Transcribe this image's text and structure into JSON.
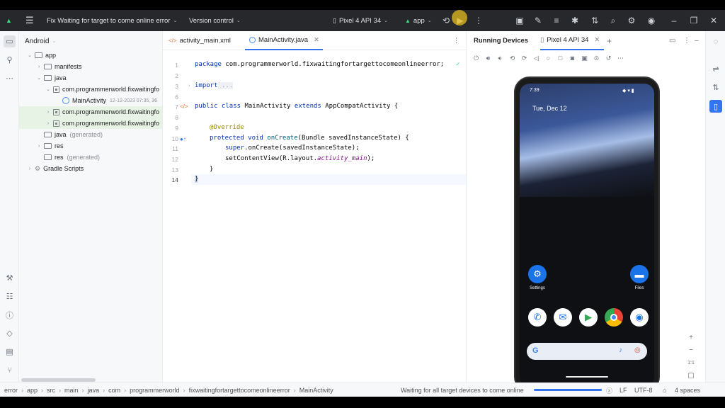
{
  "toolbar": {
    "project_name": "Fix Waiting for target to come online error",
    "version_control": "Version control",
    "device": "Pixel 4 API 34",
    "run_config": "app"
  },
  "project": {
    "view_selector": "Android",
    "tree": [
      {
        "label": "app",
        "indent": 0,
        "icon": "folder",
        "arrow": "down"
      },
      {
        "label": "manifests",
        "indent": 1,
        "icon": "folder",
        "arrow": "right"
      },
      {
        "label": "java",
        "indent": 1,
        "icon": "folder",
        "arrow": "down"
      },
      {
        "label": "com.programmerworld.fixwaitingfo",
        "indent": 2,
        "icon": "package",
        "arrow": "down"
      },
      {
        "label": "MainActivity",
        "suffix": "12-12-2023 07:35, 36",
        "indent": 3,
        "icon": "class",
        "arrow": ""
      },
      {
        "label": "com.programmerworld.fixwaitingfo",
        "indent": 2,
        "icon": "package",
        "arrow": "right",
        "selected": true
      },
      {
        "label": "com.programmerworld.fixwaitingfo",
        "indent": 2,
        "icon": "package",
        "arrow": "right",
        "selected": true
      },
      {
        "label": "java",
        "suffix": "(generated)",
        "indent": 1,
        "icon": "folder",
        "arrow": ""
      },
      {
        "label": "res",
        "indent": 1,
        "icon": "folder",
        "arrow": "right"
      },
      {
        "label": "res",
        "suffix": "(generated)",
        "indent": 1,
        "icon": "folder",
        "arrow": ""
      },
      {
        "label": "Gradle Scripts",
        "indent": 0,
        "icon": "gradle",
        "arrow": "right"
      }
    ]
  },
  "editor": {
    "tabs": [
      {
        "label": "activity_main.xml",
        "active": false
      },
      {
        "label": "MainActivity.java",
        "active": true
      }
    ],
    "line_numbers": [
      "1",
      "2",
      "3",
      "6",
      "7",
      "8",
      "9",
      "10",
      "11",
      "12",
      "13",
      "14"
    ],
    "lines": {
      "l1_kw": "package",
      "l1_rest": " com.programmerworld.fixwaitingfortargettocomeonlineerror;",
      "l3_kw": "import",
      "l3_fold": " ...",
      "l7_kw1": "public",
      "l7_kw2": " class",
      "l7_name": " MainActivity",
      "l7_kw3": " extends",
      "l7_rest": " AppCompatActivity {",
      "l9_ann": "@Override",
      "l10_kw": "protected void",
      "l10_mt": " onCreate",
      "l10_rest": "(Bundle savedInstanceState) {",
      "l11_kw": "super",
      "l11_rest": ".onCreate(savedInstanceState);",
      "l12_pre": "setContentView(R.layout.",
      "l12_it": "activity_main",
      "l12_post": ");",
      "l13": "}",
      "l14": "}"
    }
  },
  "devices": {
    "title": "Running Devices",
    "tab": "Pixel 4 API 34",
    "add_tab": "+",
    "phone": {
      "time": "7:39",
      "date": "Tue, Dec 12",
      "apps_row1": [
        {
          "name": "Settings"
        },
        {
          "name": "Files"
        }
      ],
      "dock": [
        "phone-icon",
        "messages-icon",
        "play-store-icon",
        "chrome-icon",
        "camera-icon"
      ]
    },
    "zoom_label": "1:1"
  },
  "status": {
    "breadcrumbs": [
      "error",
      "app",
      "src",
      "main",
      "java",
      "com",
      "programmerworld",
      "fixwaitingfortargettocomeonlineerror",
      "MainActivity"
    ],
    "message": "Waiting for all target devices to come online",
    "progress": 1.0,
    "line_ending": "LF",
    "encoding": "UTF-8",
    "indent": "4 spaces"
  }
}
